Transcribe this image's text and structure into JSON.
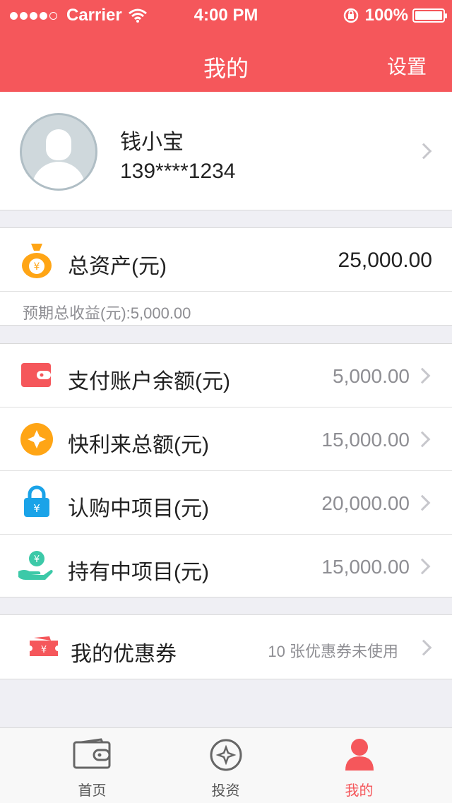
{
  "status": {
    "carrier": "Carrier",
    "time": "4:00 PM",
    "battery": "100%"
  },
  "nav": {
    "title": "我的",
    "right": "设置"
  },
  "profile": {
    "name": "钱小宝",
    "phone": "139****1234"
  },
  "assets": {
    "label": "总资产(元)",
    "value": "25,000.00",
    "sub": "预期总收益(元):5,000.00"
  },
  "items": [
    {
      "label": "支付账户余额(元)",
      "value": "5,000.00",
      "icon": "wallet-icon"
    },
    {
      "label": "快利来总额(元)",
      "value": "15,000.00",
      "icon": "diamond-coin-icon"
    },
    {
      "label": "认购中项目(元)",
      "value": "20,000.00",
      "icon": "lock-icon"
    },
    {
      "label": "持有中项目(元)",
      "value": "15,000.00",
      "icon": "hand-coin-icon"
    }
  ],
  "coupon": {
    "label": "我的优惠券",
    "value": "10 张优惠券未使用",
    "icon": "ticket-icon"
  },
  "tabs": [
    {
      "label": "首页",
      "icon": "wallet-icon"
    },
    {
      "label": "投资",
      "icon": "compass-icon"
    },
    {
      "label": "我的",
      "icon": "person-icon"
    }
  ],
  "colors": {
    "accent": "#f5575b",
    "orange": "#ffa515",
    "blue": "#1aa3e8",
    "teal": "#3cc9a8"
  }
}
